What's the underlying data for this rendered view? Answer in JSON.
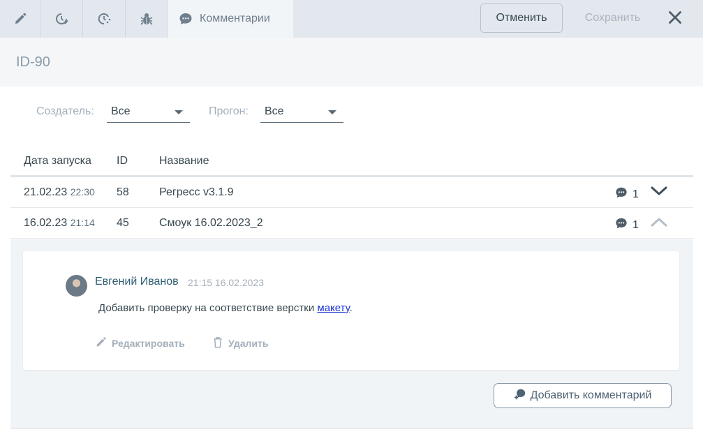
{
  "toolbar": {
    "tabs": [
      {
        "icon": "pencil-icon"
      },
      {
        "icon": "clock-check-icon"
      },
      {
        "icon": "clock-refresh-icon"
      },
      {
        "icon": "bug-icon"
      },
      {
        "icon": "comment-icon",
        "label": "Комментарии"
      }
    ],
    "cancel_label": "Отменить",
    "save_label": "Сохранить",
    "close_icon": "close-icon"
  },
  "header": {
    "title": "ID-90"
  },
  "filters": {
    "creator": {
      "label": "Создатель:",
      "value": "Все"
    },
    "run": {
      "label": "Прогон:",
      "value": "Все"
    }
  },
  "table": {
    "columns": [
      "Дата запуска",
      "ID",
      "Название"
    ],
    "rows": [
      {
        "date": "21.02.23",
        "time": "22:30",
        "id": "58",
        "name": "Регресс v3.1.9",
        "comments": "1",
        "expanded": false
      },
      {
        "date": "16.02.23",
        "time": "21:14",
        "id": "45",
        "name": "Смоук 16.02.2023_2",
        "comments": "1",
        "expanded": true
      }
    ]
  },
  "comment": {
    "author": "Евгений Иванов",
    "time": "21:15 16.02.2023",
    "text_before": "Добавить проверку на соответствие верстки ",
    "link_text": "макету",
    "text_after": ".",
    "edit_label": "Редактировать",
    "delete_label": "Удалить"
  },
  "add_comment_label": "Добавить комментарий",
  "colors": {
    "topbar": "#e3e8ee",
    "accent_text": "#2f5d74",
    "muted_text": "#a3b0bb",
    "link": "#1a33d6"
  }
}
